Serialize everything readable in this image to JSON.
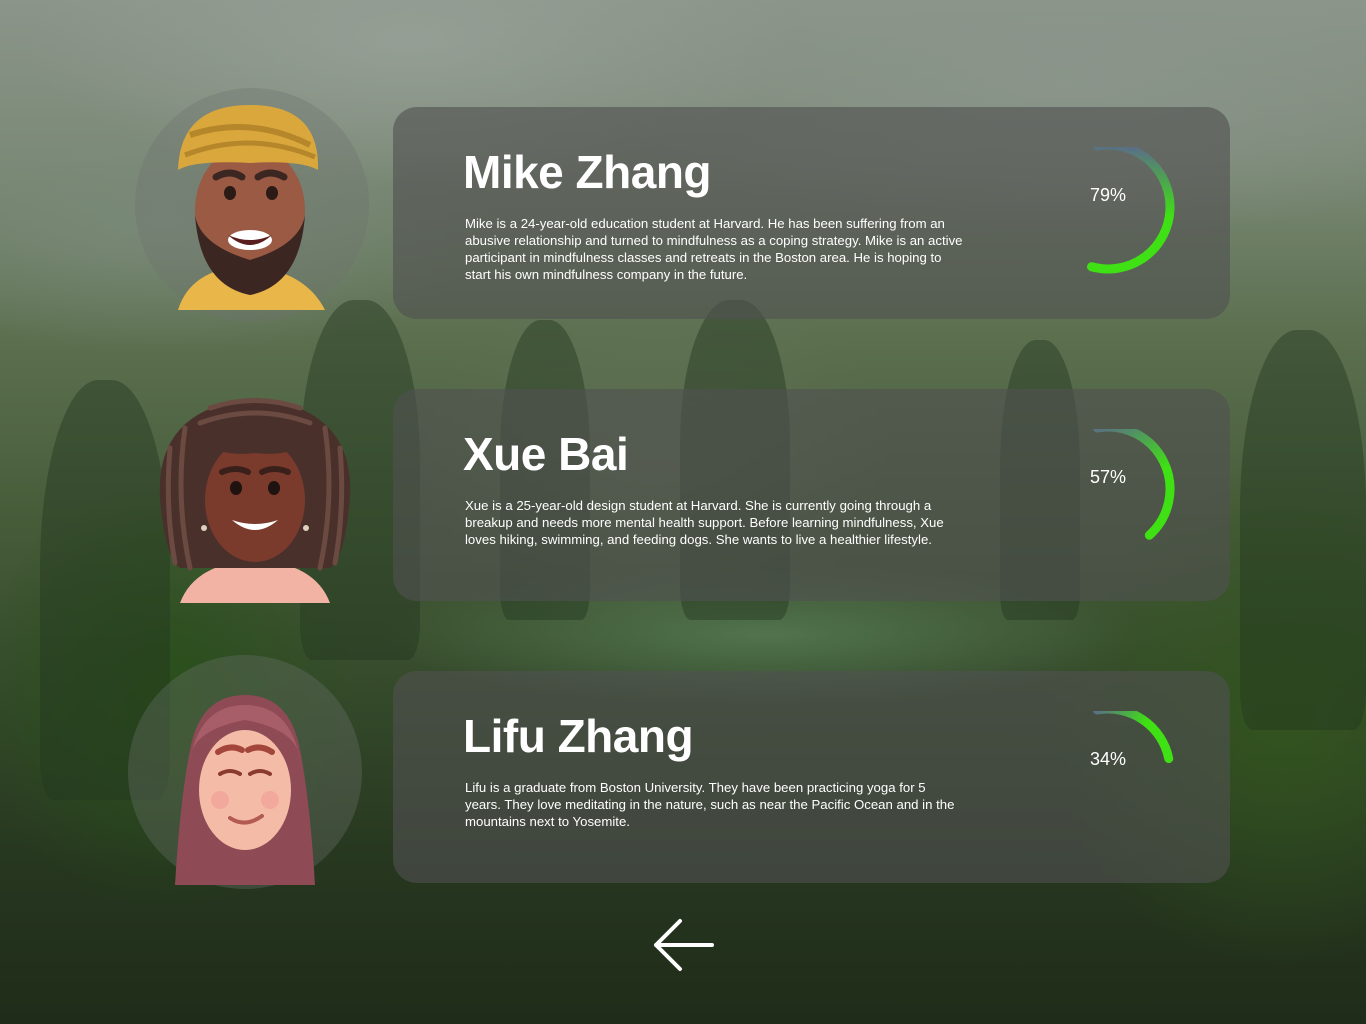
{
  "profiles": [
    {
      "name": "Mike Zhang",
      "bio": "Mike is a 24-year-old education student at Harvard. He has been suffering from an abusive relationship and turned to mindfulness as a coping strategy. Mike is an active participant in mindfulness classes and retreats in the Boston area. He is hoping to start his own mindfulness company in the future.",
      "progress_label": "79%",
      "progress": 0.79,
      "avatar_icon": "turban-man-avatar-icon"
    },
    {
      "name": "Xue Bai",
      "bio": "Xue is a 25-year-old design student at Harvard. She is currently going through a breakup and needs more mental health support. Before learning mindfulness, Xue loves hiking, swimming, and feeding dogs. She wants to live a healthier lifestyle.",
      "progress_label": "57%",
      "progress": 0.57,
      "avatar_icon": "locs-woman-avatar-icon"
    },
    {
      "name": "Lifu Zhang",
      "bio": "Lifu is a graduate from Boston University. They have been practicing yoga for 5 years. They love meditating in the nature, such as near the Pacific Ocean and in the mountains next to Yosemite.",
      "progress_label": "34%",
      "progress": 0.34,
      "avatar_icon": "hijab-woman-avatar-icon"
    }
  ],
  "navigation": {
    "back_icon": "back-arrow-icon"
  },
  "colors": {
    "gauge_start": "#5a6f86",
    "gauge_end": "#3fe014",
    "card": "#505050"
  }
}
